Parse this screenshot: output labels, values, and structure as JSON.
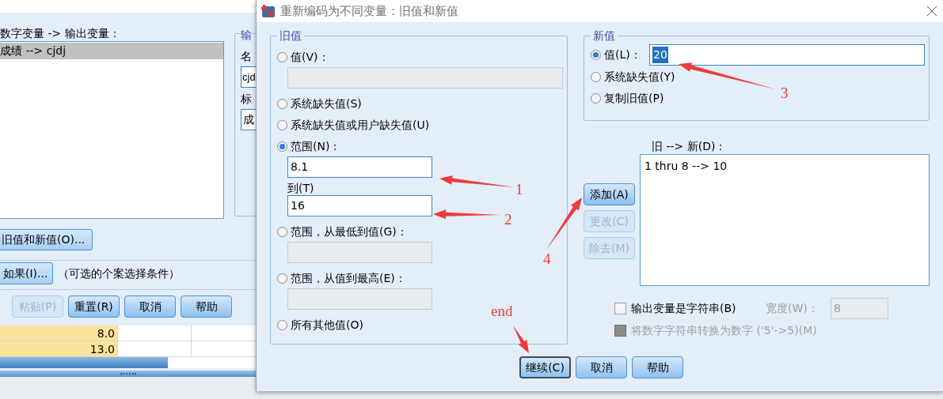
{
  "background_dialog": {
    "list_label": "数字变量 -> 输出变量：",
    "list_items": [
      {
        "text": "成绩 --> cjdj",
        "selected": true
      }
    ],
    "output_group": {
      "legend": "输",
      "name_label": "名",
      "name_value": "cjd",
      "label_label": "标",
      "label_value": "成"
    },
    "old_new_button": "旧值和新值(O)...",
    "if_button": "如果(I)...",
    "if_note": "（可选的个案选择条件）",
    "buttons": [
      {
        "label": "粘贴(P)",
        "disabled": true
      },
      {
        "label": "重置(R)",
        "disabled": false
      },
      {
        "label": "取消",
        "disabled": false
      },
      {
        "label": "帮助",
        "disabled": false
      }
    ]
  },
  "data_grid": {
    "rows": [
      {
        "value": "8.0"
      },
      {
        "value": "13.0"
      }
    ]
  },
  "dialog": {
    "title": "重新编码为不同变量：旧值和新值",
    "old_value": {
      "legend": "旧值",
      "options": [
        {
          "kind": "field",
          "label": "值(V)：",
          "selected": false,
          "field": {
            "disabled": true
          }
        },
        {
          "kind": "plain",
          "label": "系统缺失值(S)",
          "selected": false
        },
        {
          "kind": "plain",
          "label": "系统缺失值或用户缺失值(U)",
          "selected": false
        },
        {
          "kind": "range",
          "label": "范围(N)：",
          "selected": true,
          "from": {
            "value": "8.1",
            "disabled": false
          },
          "to_label": "到(T)",
          "to": {
            "value": "16",
            "disabled": false
          }
        },
        {
          "kind": "field",
          "label": "范围，从最低到值(G)：",
          "selected": false,
          "field": {
            "disabled": true
          }
        },
        {
          "kind": "field",
          "label": "范围，从值到最高(E)：",
          "selected": false,
          "field": {
            "disabled": true
          }
        },
        {
          "kind": "plain",
          "label": "所有其他值(O)",
          "selected": false
        }
      ]
    },
    "new_value": {
      "legend": "新值",
      "options": [
        {
          "kind": "field",
          "label": "值(L)：",
          "selected": true,
          "value": "20",
          "text_selected": true
        },
        {
          "kind": "plain",
          "label": "系统缺失值(Y)",
          "selected": false
        },
        {
          "kind": "plain",
          "label": "复制旧值(P)",
          "selected": false
        }
      ]
    },
    "mapping": {
      "label": "旧 --> 新(D)：",
      "items": [
        {
          "text": "1 thru 8 --> 10",
          "selected": false
        }
      ]
    },
    "side_buttons": [
      {
        "label": "添加(A)",
        "disabled": false
      },
      {
        "label": "更改(C)",
        "disabled": true
      },
      {
        "label": "除去(M)",
        "disabled": true
      }
    ],
    "string_output": {
      "label": "输出变量是字符串(B)",
      "checked": false,
      "disabled": false,
      "width_label": "宽度(W)：",
      "width_value": "8",
      "width_disabled": true
    },
    "convert": {
      "label": "将数字字符串转换为数字 ('5'->5)(M)",
      "checked": false,
      "disabled": true
    },
    "buttons": [
      {
        "label": "继续(C)",
        "default": true
      },
      {
        "label": "取消",
        "default": false
      },
      {
        "label": "帮助",
        "default": false
      }
    ]
  },
  "annotations": [
    {
      "label": "1"
    },
    {
      "label": "2"
    },
    {
      "label": "3"
    },
    {
      "label": "4"
    },
    {
      "label": "end"
    }
  ]
}
